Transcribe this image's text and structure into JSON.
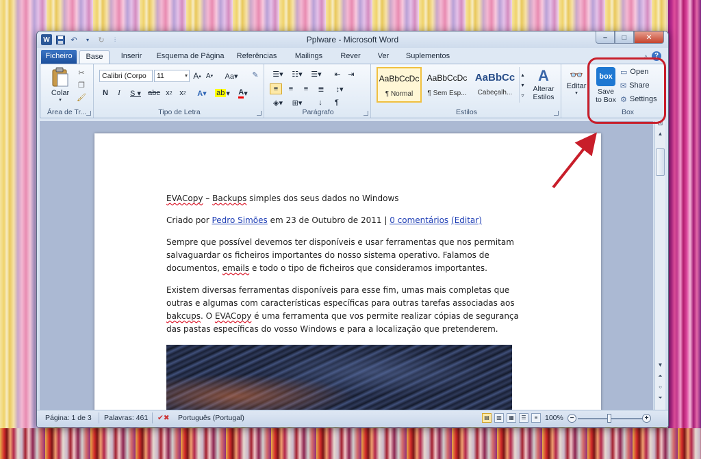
{
  "window": {
    "title": "Pplware - Microsoft Word"
  },
  "tabs": [
    {
      "label": "Ficheiro"
    },
    {
      "label": "Base"
    },
    {
      "label": "Inserir"
    },
    {
      "label": "Esquema de Página"
    },
    {
      "label": "Referências"
    },
    {
      "label": "Mailings"
    },
    {
      "label": "Rever"
    },
    {
      "label": "Ver"
    },
    {
      "label": "Suplementos"
    }
  ],
  "ribbon": {
    "clipboard": {
      "paste_label": "Colar",
      "group_label": "Área de Tr..."
    },
    "font": {
      "font_name": "Calibri (Corpo",
      "font_size": "11",
      "group_label": "Tipo de Letra"
    },
    "paragraph": {
      "group_label": "Parágrafo"
    },
    "styles": {
      "group_label": "Estilos",
      "items": [
        {
          "sample": "AaBbCcDc",
          "name": "¶ Normal"
        },
        {
          "sample": "AaBbCcDc",
          "name": "¶ Sem Esp..."
        },
        {
          "sample": "AaBbCc",
          "name": "Cabeçalh..."
        }
      ],
      "change_label": "Alterar Estilos"
    },
    "edit": {
      "label": "Editar"
    },
    "box": {
      "group_label": "Box",
      "logo_text": "box",
      "save_label": "Save to Box",
      "open_label": "Open",
      "share_label": "Share",
      "settings_label": "Settings"
    }
  },
  "document": {
    "title_a": "EVACopy",
    "title_b": " – ",
    "title_c": "Backups",
    "title_d": " simples dos seus dados no Windows",
    "meta_prefix": "Criado por ",
    "meta_author": "Pedro Simões",
    "meta_date": " em 23 de Outubro de 2011  | ",
    "meta_comments": "0 comentários",
    "meta_edit": "(Editar)",
    "p1_a": "Sempre que possível devemos ter disponíveis e usar ferramentas que nos permitam salvaguardar os ficheiros importantes do nosso sistema operativo. Falamos de documentos, ",
    "p1_b": "emails",
    "p1_c": " e todo o tipo de ficheiros que consideramos importantes.",
    "p2_a": "Existem diversas ferramentas disponíveis para esse fim, umas mais completas que outras e algumas com características específicas para outras tarefas associadas aos ",
    "p2_b": "bakcups",
    "p2_c": ". O ",
    "p2_d": "EVACopy",
    "p2_e": " é uma ferramenta que vos permite realizar cópias de segurança das pastas específicas do vosso Windows e para a localização que pretenderem."
  },
  "status": {
    "page": "Página: 1 de 3",
    "words": "Palavras: 461",
    "language": "Português (Portugal)",
    "zoom": "100%"
  },
  "colors": {
    "highlight_ring": "#c81e2a",
    "arrow": "#c81e2a",
    "file_tab": "#2a62b4"
  }
}
